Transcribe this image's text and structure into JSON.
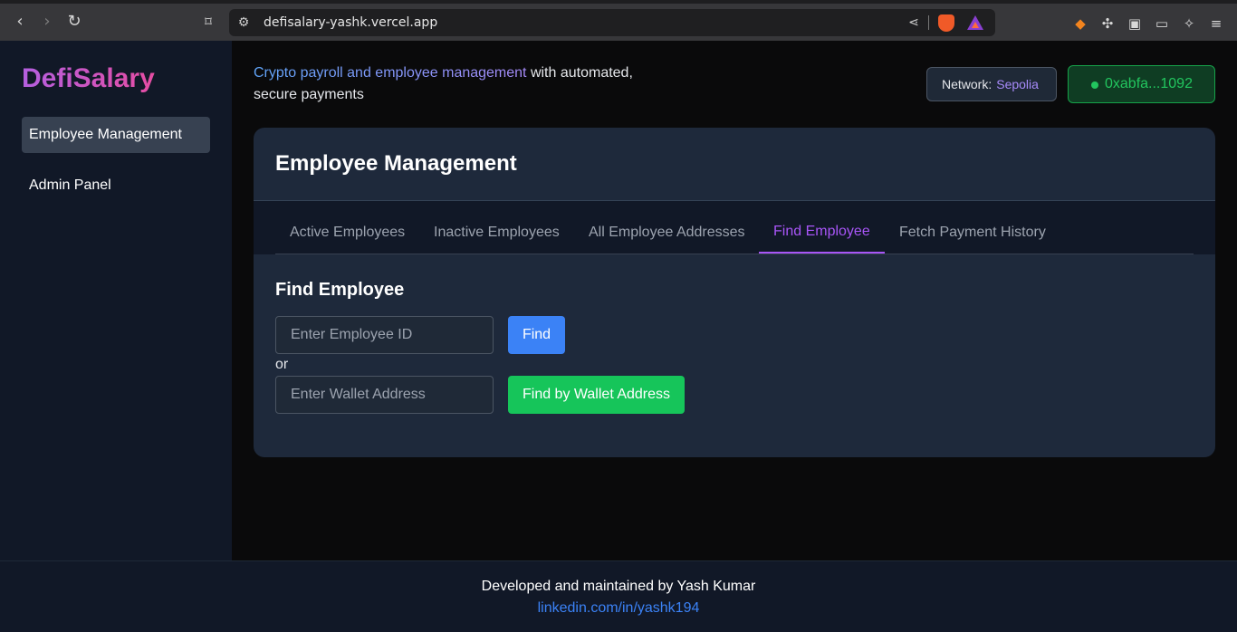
{
  "browser": {
    "url": "defisalary-yashk.vercel.app",
    "back_icon": "back-arrow-icon",
    "forward_icon": "forward-arrow-icon",
    "reload_icon": "reload-icon",
    "bookmark_icon": "bookmark-icon"
  },
  "sidebar": {
    "logo": "DefiSalary",
    "items": [
      {
        "label": "Employee Management",
        "active": true
      },
      {
        "label": "Admin Panel",
        "active": false
      }
    ]
  },
  "header": {
    "tagline_highlight": "Crypto payroll and employee management",
    "tagline_rest": " with automated, secure payments",
    "network_label": "Network:",
    "network_value": "Sepolia",
    "wallet_address": "0xabfa...1092"
  },
  "card": {
    "title": "Employee Management",
    "tabs": [
      {
        "label": "Active Employees",
        "active": false
      },
      {
        "label": "Inactive Employees",
        "active": false
      },
      {
        "label": "All Employee Addresses",
        "active": false
      },
      {
        "label": "Find Employee",
        "active": true
      },
      {
        "label": "Fetch Payment History",
        "active": false
      }
    ],
    "section_title": "Find Employee",
    "employee_id_placeholder": "Enter Employee ID",
    "find_button": "Find",
    "or_text": "or",
    "wallet_placeholder": "Enter Wallet Address",
    "find_wallet_button": "Find by Wallet Address"
  },
  "footer": {
    "credit": "Developed and maintained by Yash Kumar",
    "link": "linkedin.com/in/yashk194"
  },
  "colors": {
    "accent_purple": "#a855f7",
    "find_blue": "#3b82f6",
    "find_green": "#16c55a",
    "wallet_green": "#22c55e"
  }
}
